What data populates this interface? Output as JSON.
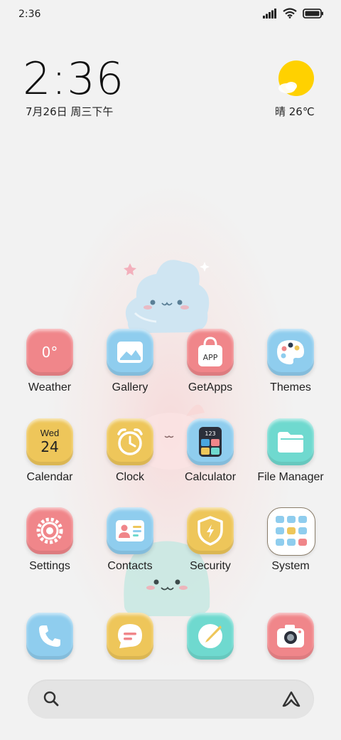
{
  "status_bar": {
    "time": "2:36"
  },
  "clock_widget": {
    "time": "2:36",
    "date": "7月26日 周三下午"
  },
  "weather_widget": {
    "text": "晴 26℃"
  },
  "apps": {
    "weather": {
      "label": "Weather",
      "icon_text": "0°"
    },
    "gallery": {
      "label": "Gallery"
    },
    "getapps": {
      "label": "GetApps",
      "icon_text": "APP"
    },
    "themes": {
      "label": "Themes"
    },
    "calendar": {
      "label": "Calendar",
      "icon_day": "Wed",
      "icon_date": "24"
    },
    "clock": {
      "label": "Clock"
    },
    "calculator": {
      "label": "Calculator",
      "icon_text": "123"
    },
    "file_manager": {
      "label": "File Manager"
    },
    "settings": {
      "label": "Settings"
    },
    "contacts": {
      "label": "Contacts"
    },
    "security": {
      "label": "Security"
    },
    "system": {
      "label": "System"
    }
  },
  "dock": [
    "phone-icon",
    "messages-icon",
    "browser-icon",
    "camera-icon"
  ],
  "colors": {
    "pink": "#f0868a",
    "blue": "#8fcdee",
    "yellow": "#eec65a",
    "teal": "#6fd9cf",
    "background": "#f2f2f2"
  }
}
